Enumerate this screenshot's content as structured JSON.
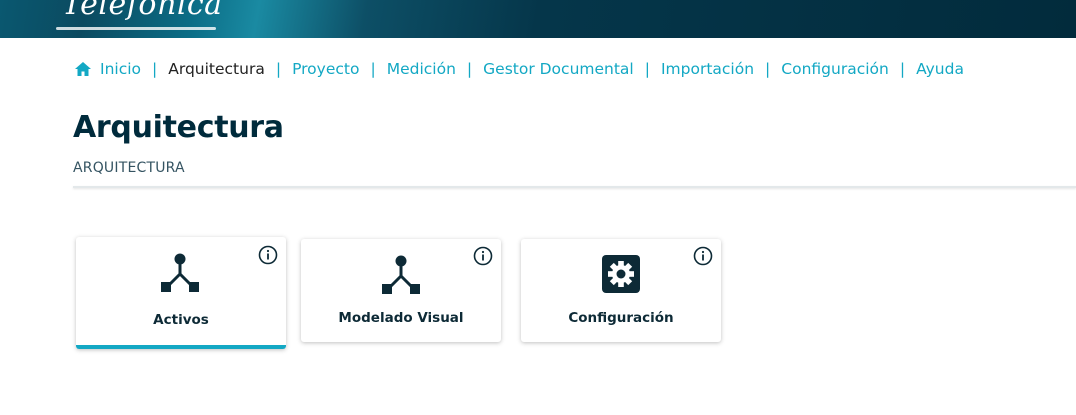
{
  "header": {
    "logo_text": "Telefónica"
  },
  "nav": {
    "home_label": "Inicio",
    "items": [
      {
        "label": "Arquitectura"
      },
      {
        "label": "Proyecto"
      },
      {
        "label": "Medición"
      },
      {
        "label": "Gestor Documental"
      },
      {
        "label": "Importación"
      },
      {
        "label": "Configuración"
      },
      {
        "label": "Ayuda"
      }
    ],
    "separator": "|"
  },
  "page": {
    "title": "Arquitectura",
    "subtitle": "ARQUITECTURA"
  },
  "cards": [
    {
      "label": "Activos",
      "icon": "hierarchy-icon",
      "active": true
    },
    {
      "label": "Modelado Visual",
      "icon": "hierarchy-icon",
      "active": false
    },
    {
      "label": "Configuración",
      "icon": "gear-icon",
      "active": false
    }
  ],
  "colors": {
    "accent": "#13a8c4",
    "title": "#002b3c",
    "icon": "#0d2a36"
  }
}
